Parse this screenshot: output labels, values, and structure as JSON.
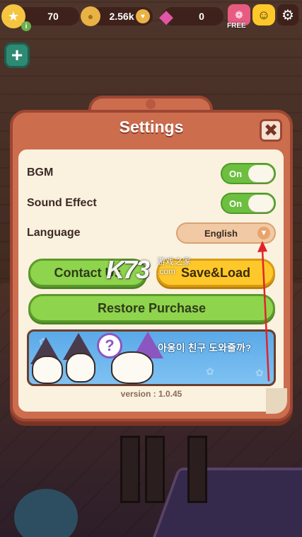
{
  "hud": {
    "stars": "70",
    "coins": "2.56k",
    "gems": "0",
    "free_label": "FREE",
    "info_badge": "i"
  },
  "dialog": {
    "title": "Settings",
    "close_glyph": "✖",
    "rows": {
      "bgm_label": "BGM",
      "bgm_state": "On",
      "sound_label": "Sound Effect",
      "sound_state": "On",
      "language_label": "Language",
      "language_value": "English"
    },
    "buttons": {
      "contact": "Contact Us",
      "save_load": "Save&Load",
      "restore": "Restore Purchase"
    },
    "banner_text": "아옹이 친구 도와줄까?",
    "banner_bubble": "?",
    "version": "version : 1.0.45"
  },
  "watermark": {
    "logo": "K73",
    "cn": "游戏之家",
    "com": ".com"
  },
  "colors": {
    "dialog": "#cc6d4e",
    "panel": "#fbf1df",
    "toggle_on": "#6dbf3f",
    "button_green": "#8fd44d",
    "button_yellow": "#ffc82a",
    "annotation_arrow": "#e0242a"
  },
  "icons": {
    "star": "star-icon",
    "coin": "coin-icon",
    "gem": "gem-icon",
    "gift": "gift-icon",
    "gamepad": "gamepad-icon",
    "gear": "gear-icon",
    "plus": "plus-icon",
    "chevron": "chevron-down-icon"
  }
}
